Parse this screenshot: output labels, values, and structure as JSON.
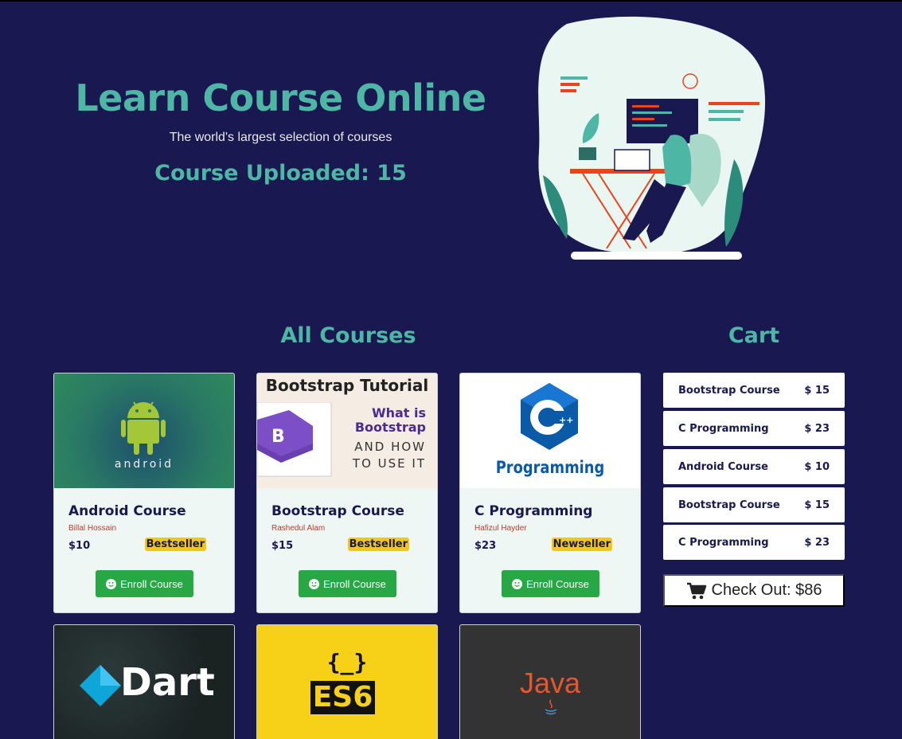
{
  "hero": {
    "title": "Learn Course Online",
    "subtitle": "The world's largest selection of courses",
    "count_text": "Course Uploaded: 15"
  },
  "sections": {
    "courses_title": "All Courses",
    "cart_title": "Cart"
  },
  "courses": [
    {
      "name": "Android Course",
      "author": "Billal Hossain",
      "price": "$10",
      "badge": "Bestseller",
      "enroll": "Enroll Course",
      "thumb_text": "android"
    },
    {
      "name": "Bootstrap Course",
      "author": "Rashedul Alam",
      "price": "$15",
      "badge": "Bestseller",
      "enroll": "Enroll Course",
      "thumb_title": "Bootstrap Tutorial",
      "thumb_line1": "What is",
      "thumb_line2": "Bootstrap",
      "thumb_line3": "AND HOW",
      "thumb_line4": "TO USE IT"
    },
    {
      "name": "C Programming",
      "author": "Hafizul Hayder",
      "price": "$23",
      "badge": "Newseller",
      "enroll": "Enroll Course",
      "thumb_text": "Programming"
    },
    {
      "thumb_text": "Dart"
    },
    {
      "thumb_text": "ES6",
      "thumb_braces": "{_}"
    },
    {
      "thumb_text": "Java"
    }
  ],
  "cart": {
    "items": [
      {
        "name": "Bootstrap Course",
        "price": "$ 15"
      },
      {
        "name": "C Programming",
        "price": "$ 23"
      },
      {
        "name": "Android Course",
        "price": "$ 10"
      },
      {
        "name": "Bootstrap Course",
        "price": "$ 15"
      },
      {
        "name": "C Programming",
        "price": "$ 23"
      }
    ],
    "checkout": "Check Out: $86"
  },
  "colors": {
    "background": "#1a1850",
    "accent": "#4db6a4",
    "enroll_button": "#28a745",
    "badge": "#f5c518"
  },
  "icons": [
    "smile-icon",
    "cart-icon",
    "android-logo-icon",
    "bootstrap-logo-icon",
    "cpp-logo-icon",
    "dart-logo-icon",
    "java-logo-icon"
  ]
}
